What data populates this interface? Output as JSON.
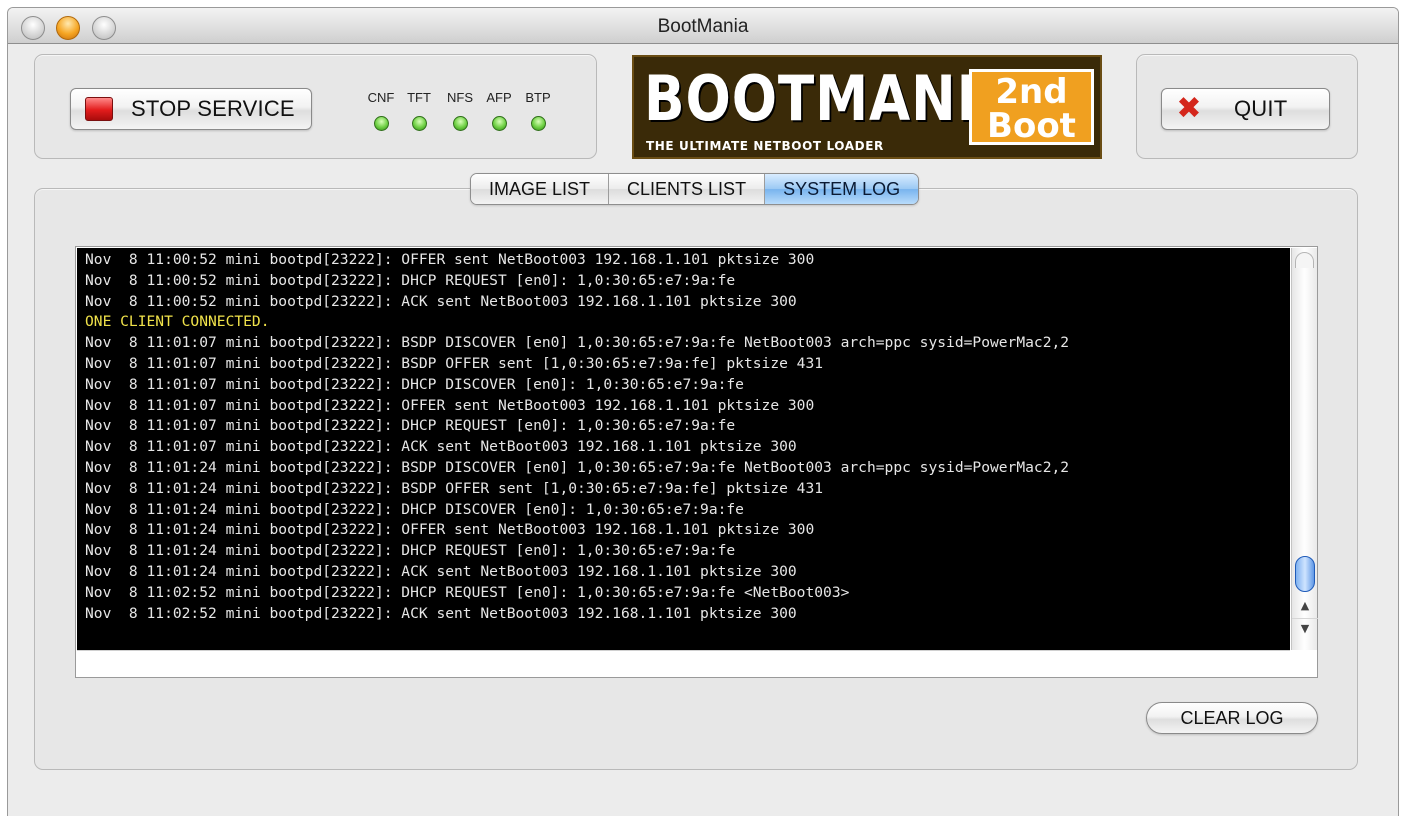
{
  "window": {
    "title": "BootMania"
  },
  "toolbar": {
    "stop_label": "STOP SERVICE",
    "quit_label": "QUIT",
    "indicators": [
      {
        "label": "CNF",
        "status": "on"
      },
      {
        "label": "TFT",
        "status": "on"
      },
      {
        "label": "NFS",
        "status": "on"
      },
      {
        "label": "AFP",
        "status": "on"
      },
      {
        "label": "BTP",
        "status": "on"
      }
    ]
  },
  "logo": {
    "main": "BOOTMANIA",
    "subtitle": "THE ULTIMATE NETBOOT LOADER",
    "badge_line1": "2nd",
    "badge_line2": "Boot",
    "colors": {
      "background": "#3a2a08",
      "badge": "#f0a020"
    }
  },
  "tabs": [
    {
      "label": "IMAGE LIST",
      "active": false
    },
    {
      "label": "CLIENTS LIST",
      "active": false
    },
    {
      "label": "SYSTEM LOG",
      "active": true
    }
  ],
  "log": {
    "lines": [
      {
        "text": "Nov  8 11:00:52 mini bootpd[23222]: OFFER sent NetBoot003 192.168.1.101 pktsize 300",
        "highlight": false
      },
      {
        "text": "Nov  8 11:00:52 mini bootpd[23222]: DHCP REQUEST [en0]: 1,0:30:65:e7:9a:fe",
        "highlight": false
      },
      {
        "text": "Nov  8 11:00:52 mini bootpd[23222]: ACK sent NetBoot003 192.168.1.101 pktsize 300",
        "highlight": false
      },
      {
        "text": "ONE CLIENT CONNECTED.",
        "highlight": true
      },
      {
        "text": "Nov  8 11:01:07 mini bootpd[23222]: BSDP DISCOVER [en0] 1,0:30:65:e7:9a:fe NetBoot003 arch=ppc sysid=PowerMac2,2",
        "highlight": false
      },
      {
        "text": "Nov  8 11:01:07 mini bootpd[23222]: BSDP OFFER sent [1,0:30:65:e7:9a:fe] pktsize 431",
        "highlight": false
      },
      {
        "text": "Nov  8 11:01:07 mini bootpd[23222]: DHCP DISCOVER [en0]: 1,0:30:65:e7:9a:fe",
        "highlight": false
      },
      {
        "text": "Nov  8 11:01:07 mini bootpd[23222]: OFFER sent NetBoot003 192.168.1.101 pktsize 300",
        "highlight": false
      },
      {
        "text": "Nov  8 11:01:07 mini bootpd[23222]: DHCP REQUEST [en0]: 1,0:30:65:e7:9a:fe",
        "highlight": false
      },
      {
        "text": "Nov  8 11:01:07 mini bootpd[23222]: ACK sent NetBoot003 192.168.1.101 pktsize 300",
        "highlight": false
      },
      {
        "text": "Nov  8 11:01:24 mini bootpd[23222]: BSDP DISCOVER [en0] 1,0:30:65:e7:9a:fe NetBoot003 arch=ppc sysid=PowerMac2,2",
        "highlight": false
      },
      {
        "text": "Nov  8 11:01:24 mini bootpd[23222]: BSDP OFFER sent [1,0:30:65:e7:9a:fe] pktsize 431",
        "highlight": false
      },
      {
        "text": "Nov  8 11:01:24 mini bootpd[23222]: DHCP DISCOVER [en0]: 1,0:30:65:e7:9a:fe",
        "highlight": false
      },
      {
        "text": "Nov  8 11:01:24 mini bootpd[23222]: OFFER sent NetBoot003 192.168.1.101 pktsize 300",
        "highlight": false
      },
      {
        "text": "Nov  8 11:01:24 mini bootpd[23222]: DHCP REQUEST [en0]: 1,0:30:65:e7:9a:fe",
        "highlight": false
      },
      {
        "text": "Nov  8 11:01:24 mini bootpd[23222]: ACK sent NetBoot003 192.168.1.101 pktsize 300",
        "highlight": false
      },
      {
        "text": "Nov  8 11:02:52 mini bootpd[23222]: DHCP REQUEST [en0]: 1,0:30:65:e7:9a:fe <NetBoot003>",
        "highlight": false
      },
      {
        "text": "Nov  8 11:02:52 mini bootpd[23222]: ACK sent NetBoot003 192.168.1.101 pktsize 300",
        "highlight": false
      }
    ],
    "colors": {
      "background": "#000000",
      "text": "#e6e6e6",
      "highlight": "#f0e24a"
    }
  },
  "actions": {
    "clear_label": "CLEAR LOG"
  },
  "icons": {
    "stop": "stop-square-icon",
    "quit": "red-x-icon",
    "led": "green-led-icon",
    "scroll_up": "scroll-up-arrow-icon",
    "scroll_down": "scroll-down-arrow-icon"
  }
}
